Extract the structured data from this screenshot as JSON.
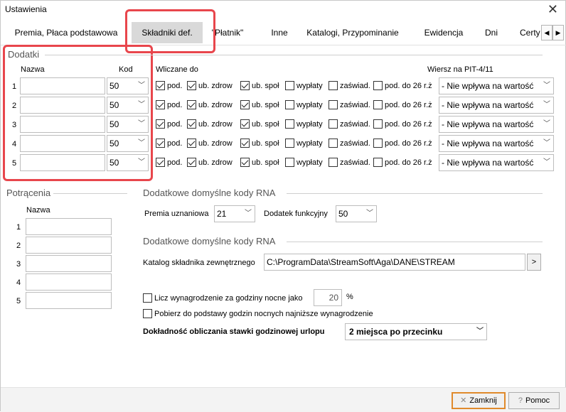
{
  "window": {
    "title": "Ustawienia",
    "close": "✕"
  },
  "tabs": [
    {
      "label": "Premia, Płaca podstawowa"
    },
    {
      "label": "Składniki def."
    },
    {
      "label": "\"Płatnik\""
    },
    {
      "label": "Inne"
    },
    {
      "label": "Katalogi, Przypominanie"
    },
    {
      "label": "Ewidencja"
    },
    {
      "label": "Dni"
    },
    {
      "label": "Certy"
    }
  ],
  "tab_scroll": {
    "left": "◀",
    "right": "▶"
  },
  "dodatki": {
    "title": "Dodatki",
    "col_nazwa": "Nazwa",
    "col_kod": "Kod",
    "col_wliczane": "Wliczane do",
    "col_wiersz": "Wiersz na PIT-4/11",
    "rows": [
      {
        "num": "1",
        "kod": "50",
        "checks": [
          true,
          true,
          true,
          false,
          false,
          false
        ],
        "pit": "- Nie wpływa na wartość"
      },
      {
        "num": "2",
        "kod": "50",
        "checks": [
          true,
          true,
          true,
          false,
          false,
          false
        ],
        "pit": "- Nie wpływa na wartość"
      },
      {
        "num": "3",
        "kod": "50",
        "checks": [
          true,
          true,
          true,
          false,
          false,
          false
        ],
        "pit": "- Nie wpływa na wartość"
      },
      {
        "num": "4",
        "kod": "50",
        "checks": [
          true,
          true,
          true,
          false,
          false,
          false
        ],
        "pit": "- Nie wpływa na wartość"
      },
      {
        "num": "5",
        "kod": "50",
        "checks": [
          true,
          true,
          true,
          false,
          false,
          false
        ],
        "pit": "- Nie wpływa na wartość"
      }
    ],
    "check_labels": [
      "pod.",
      "ub. zdrow",
      "ub. społ",
      "wypłaty",
      "zaświad.",
      "pod. do 26 r.ż"
    ]
  },
  "potracenia": {
    "title": "Potrącenia",
    "col_nazwa": "Nazwa",
    "rows": [
      "1",
      "2",
      "3",
      "4",
      "5"
    ]
  },
  "rna1": {
    "title": "Dodatkowe domyślne kody RNA",
    "premia_label": "Premia uznaniowa",
    "premia_value": "21",
    "dodatek_label": "Dodatek funkcyjny",
    "dodatek_value": "50"
  },
  "rna2": {
    "title": "Dodatkowe domyślne kody RNA",
    "katalog_label": "Katalog składnika zewnętrznego",
    "katalog_value": "C:\\ProgramData\\StreamSoft\\Aga\\DANE\\STREAM",
    "browse": ">"
  },
  "options": {
    "licz_label": "Licz wynagrodzenie za godziny nocne jako",
    "licz_value": "20",
    "licz_unit": "%",
    "pobierz_label": "Pobierz do podstawy godzin nocnych najniższe wynagrodzenie",
    "dokladnosc_label": "Dokładność obliczania stawki godzinowej urlopu",
    "dokladnosc_value": "2 miejsca po przecinku"
  },
  "buttons": {
    "close": "Zamknij",
    "help": "Pomoc"
  },
  "colors": {
    "highlight": "#e8464c",
    "primary_border": "#e08a2c"
  }
}
